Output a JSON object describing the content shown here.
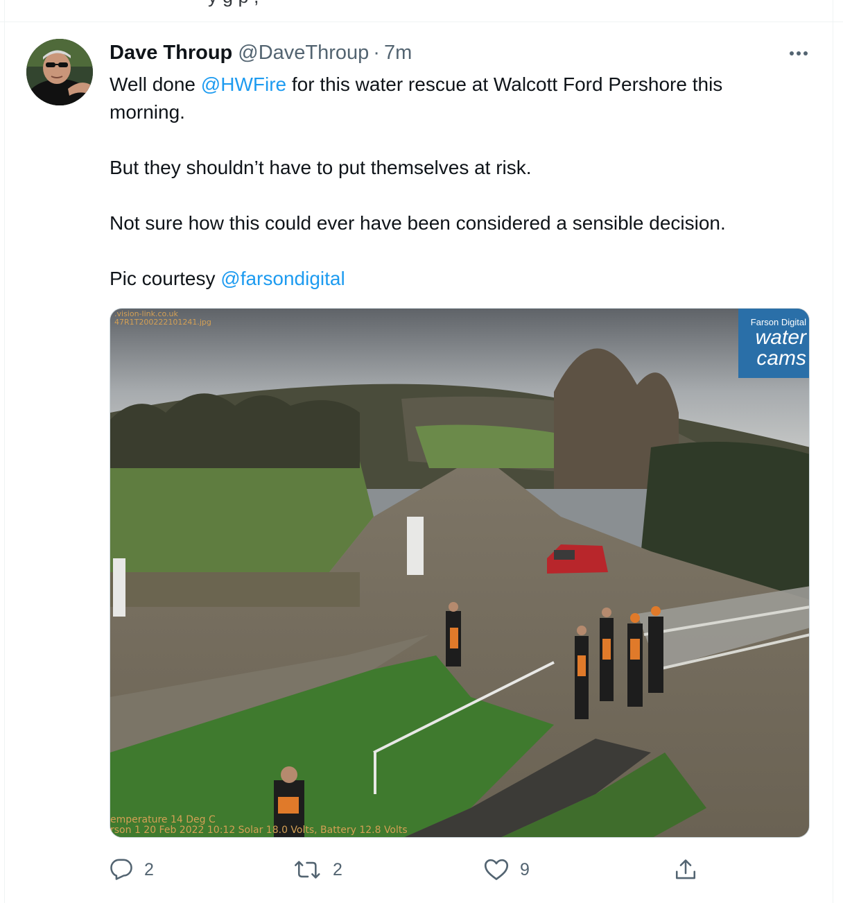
{
  "tweet": {
    "author_name": "Dave Throup",
    "author_handle": "@DaveThroup",
    "separator": "·",
    "time": "7m",
    "body": {
      "p1_pre": "Well done ",
      "p1_mention": "@HWFire",
      "p1_post": " for this water rescue at Walcott Ford Pershore this morning.",
      "p2": "But they shouldn’t have to put themselves at risk.",
      "p3": "Not sure how this could ever have been considered a sensible decision.",
      "p4_pre": "Pic courtesy ",
      "p4_mention": "@farsondigital"
    },
    "media": {
      "overlay_top_line1": ".vision-link.co.uk",
      "overlay_top_line2": "47R1T200222101241.jpg",
      "overlay_bottom_line1": "emperature 14 Deg C",
      "overlay_bottom_line2": "rson 1 20 Feb 2022 10:12 Solar 18.0 Volts, Battery 12.8 Volts",
      "logo_line1": "Farson Digital",
      "logo_line2": "water",
      "logo_line3": "cams"
    },
    "actions": {
      "reply_count": "2",
      "retweet_count": "2",
      "like_count": "9"
    }
  },
  "top_strip_text": "y                    g     p                  ,",
  "icons": {
    "more": "more-dots-icon",
    "reply": "reply-icon",
    "retweet": "retweet-icon",
    "like": "heart-icon",
    "share": "share-icon"
  },
  "colors": {
    "link": "#1d9bf0",
    "secondary_text": "#536471",
    "primary_text": "#0f1419",
    "border": "#cfd9de"
  }
}
